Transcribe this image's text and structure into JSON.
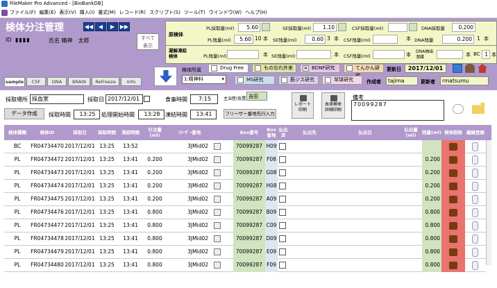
{
  "window": {
    "title": "FileMaker Pro Advanced - [BioBankDB]"
  },
  "menu": [
    "ファイル(F)",
    "編集(E)",
    "表示(V)",
    "挿入(I)",
    "書式(M)",
    "レコード(R)",
    "スクリプト(S)",
    "ツール(T)",
    "ウインドウ(W)",
    "ヘルプ(H)"
  ],
  "header": {
    "title": "検体分注管理",
    "id_label": "ID",
    "id_value": "▮▮▮▮",
    "name_label": "氏名",
    "name_value": "精神　太郎",
    "all_label_1": "すべて",
    "all_label_2": "表示"
  },
  "nav": {
    "first": "◀◀",
    "prev": "◀",
    "next": "▶",
    "last": "▶▶"
  },
  "top": {
    "genkentai": "原検体",
    "pl_collect_label": "PL採取量(ml)",
    "pl_collect": "5.60",
    "se_collect_label": "SE採取量(ml)",
    "se_collect": "1.10",
    "csf_collect_label": "CSF採取量(ml)",
    "csf_collect": "",
    "dna_collect_label": "DNA採取量",
    "dna_collect": "0.200",
    "pl_remain_label": "PL残量(ml)",
    "pl_remain": "5.60",
    "pl_count": "10",
    "hon": "本",
    "se_count_label": "SE残量(ml)",
    "se_remain": "0.60",
    "se_count": "3",
    "csf_remain_label": "CSF残量(ml)",
    "csf_remain": "",
    "dna_count_label": "DNA残量",
    "dna_remain": "0.200",
    "dna_count": "1",
    "frozen_label": "凝解凍結検体",
    "pl2_label": "PL残量(ml)",
    "se2_label": "SE残量(ml)",
    "csf2_label": "CSF残量(ml)",
    "dna2_label": "DNA抽出溶媒",
    "bc_label": "BC",
    "bc_count": "1"
  },
  "tabs": [
    "sample",
    "CSF",
    "DNA",
    "BRAIN",
    "ReFreeze",
    "Info"
  ],
  "dept": {
    "label": "検体所属",
    "value": "1:精神科"
  },
  "checks": [
    {
      "label": "Drug Free",
      "checked": false
    },
    {
      "label": "もの忘れ外来",
      "checked": false
    },
    {
      "label": "BDNF研究",
      "checked": true
    },
    {
      "label": "てんかん研究",
      "checked": false
    },
    {
      "label": "MS研究",
      "checked": false
    },
    {
      "label": "筋ジス研究",
      "checked": false
    },
    {
      "label": "琴球研究",
      "checked": false
    }
  ],
  "meta": {
    "updated_label": "更新日",
    "updated": "2017/12/01",
    "creator_label": "作成者",
    "creator": "tajima",
    "updater_label": "更新者",
    "updater": "rmatsumu"
  },
  "form": {
    "place_label": "採取場所",
    "place": "採血室",
    "date_label": "採取日",
    "date": "2017/12/01",
    "meal_label": "食事時間",
    "meal": "7:15",
    "main_label": "主治医(仮置き)",
    "main_value": "吉田",
    "data_btn": "データ作成",
    "collect_time_label": "採取時間",
    "collect_time": "13:25",
    "proc_label": "処理開始時間",
    "proc_time": "13:28",
    "freeze_label": "凍結時間",
    "freeze_time": "13:41",
    "freezer_btn": "フリーザー番地先行入力",
    "report_btn_1": "レポート",
    "report_btn_2": "印刷",
    "blood_btn_1": "血液検体",
    "blood_btn_2": "詳細印刷",
    "note_label": "備考",
    "note": "70099287"
  },
  "columns": [
    "検体種類",
    "検体ID",
    "採取日",
    "採取時間",
    "凍結時間",
    "分注量(ml)",
    "ﾌﾘｰｻﾞｰ番地",
    "Box番号",
    "Box番地",
    "払出済",
    "払出先",
    "払出日",
    "払出量(ml)",
    "残量(ml)",
    "検体削除",
    "繊維登録"
  ],
  "rows": [
    {
      "type": "BC",
      "id": "FR04734470",
      "date": "2017/12/01",
      "ctime": "13:25",
      "ftime": "13:52",
      "vol": "",
      "freezer": "3JMid02",
      "box": "70099287",
      "pos": "H09",
      "remain": ""
    },
    {
      "type": "PL",
      "id": "FR04734472",
      "date": "2017/12/01",
      "ctime": "13:25",
      "ftime": "13:41",
      "vol": "0.200",
      "freezer": "3JMid02",
      "box": "70099287",
      "pos": "F08",
      "remain": "0.200"
    },
    {
      "type": "PL",
      "id": "FR04734473",
      "date": "2017/12/01",
      "ctime": "13:25",
      "ftime": "13:41",
      "vol": "0.200",
      "freezer": "3JMid02",
      "box": "70099287",
      "pos": "G08",
      "remain": "0.200"
    },
    {
      "type": "PL",
      "id": "FR04734474",
      "date": "2017/12/01",
      "ctime": "13:25",
      "ftime": "13:41",
      "vol": "0.200",
      "freezer": "3JMid02",
      "box": "70099287",
      "pos": "H08",
      "remain": "0.200"
    },
    {
      "type": "PL",
      "id": "FR04734475",
      "date": "2017/12/01",
      "ctime": "13:25",
      "ftime": "13:41",
      "vol": "0.200",
      "freezer": "3JMid02",
      "box": "70099287",
      "pos": "A09",
      "remain": "0.200"
    },
    {
      "type": "PL",
      "id": "FR04734476",
      "date": "2017/12/01",
      "ctime": "13:25",
      "ftime": "13:41",
      "vol": "0.800",
      "freezer": "3JMid02",
      "box": "70099287",
      "pos": "B09",
      "remain": "0.800"
    },
    {
      "type": "PL",
      "id": "FR04734477",
      "date": "2017/12/01",
      "ctime": "13:25",
      "ftime": "13:41",
      "vol": "0.800",
      "freezer": "3JMid02",
      "box": "70099287",
      "pos": "C09",
      "remain": "0.800"
    },
    {
      "type": "PL",
      "id": "FR04734478",
      "date": "2017/12/01",
      "ctime": "13:25",
      "ftime": "13:41",
      "vol": "0.800",
      "freezer": "3JMid02",
      "box": "70099287",
      "pos": "D09",
      "remain": "0.800"
    },
    {
      "type": "PL",
      "id": "FR04734479",
      "date": "2017/12/01",
      "ctime": "13:25",
      "ftime": "13:41",
      "vol": "0.800",
      "freezer": "3JMid02",
      "box": "70099287",
      "pos": "E09",
      "remain": "0.800"
    },
    {
      "type": "PL",
      "id": "FR04734480",
      "date": "2017/12/01",
      "ctime": "13:25",
      "ftime": "13:41",
      "vol": "0.800",
      "freezer": "3JMid02",
      "box": "70099287",
      "pos": "F09",
      "remain": "0.800"
    }
  ],
  "colors": {
    "header": "#b09acb",
    "accent": "#1a3f8f",
    "green": "#cfe4bf",
    "red": "#e9736e"
  }
}
